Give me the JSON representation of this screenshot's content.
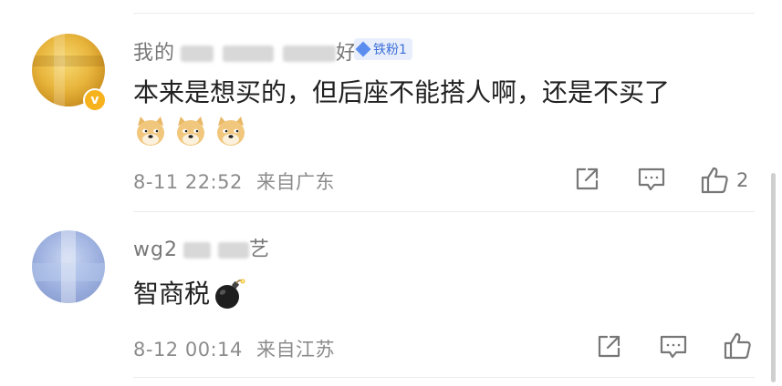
{
  "comments": [
    {
      "username_visible": "我的",
      "username_tail": "好",
      "fan_badge": "铁粉1",
      "verified_badge": "v",
      "text": "本来是想买的，但后座不能搭人啊，还是不买了",
      "emojis": [
        "doge",
        "doge",
        "doge"
      ],
      "time": "8-11 22:52",
      "location": "来自广东",
      "like_count": "2",
      "icons": {
        "share": "share-icon",
        "comment": "comment-icon",
        "like": "thumbs-up-icon"
      }
    },
    {
      "username_visible": "wg2",
      "username_tail": "艺",
      "text": "智商税",
      "emojis": [
        "bomb"
      ],
      "time": "8-12 00:14",
      "location": "来自江苏",
      "like_count": "",
      "icons": {
        "share": "share-icon",
        "comment": "comment-icon",
        "like": "thumbs-up-icon"
      }
    }
  ],
  "colors": {
    "meta_text": "#8c8c8c",
    "fan_badge_bg": "#e8eefc",
    "fan_badge_text": "#3b6fd8",
    "verified_badge": "#f6b31e"
  }
}
